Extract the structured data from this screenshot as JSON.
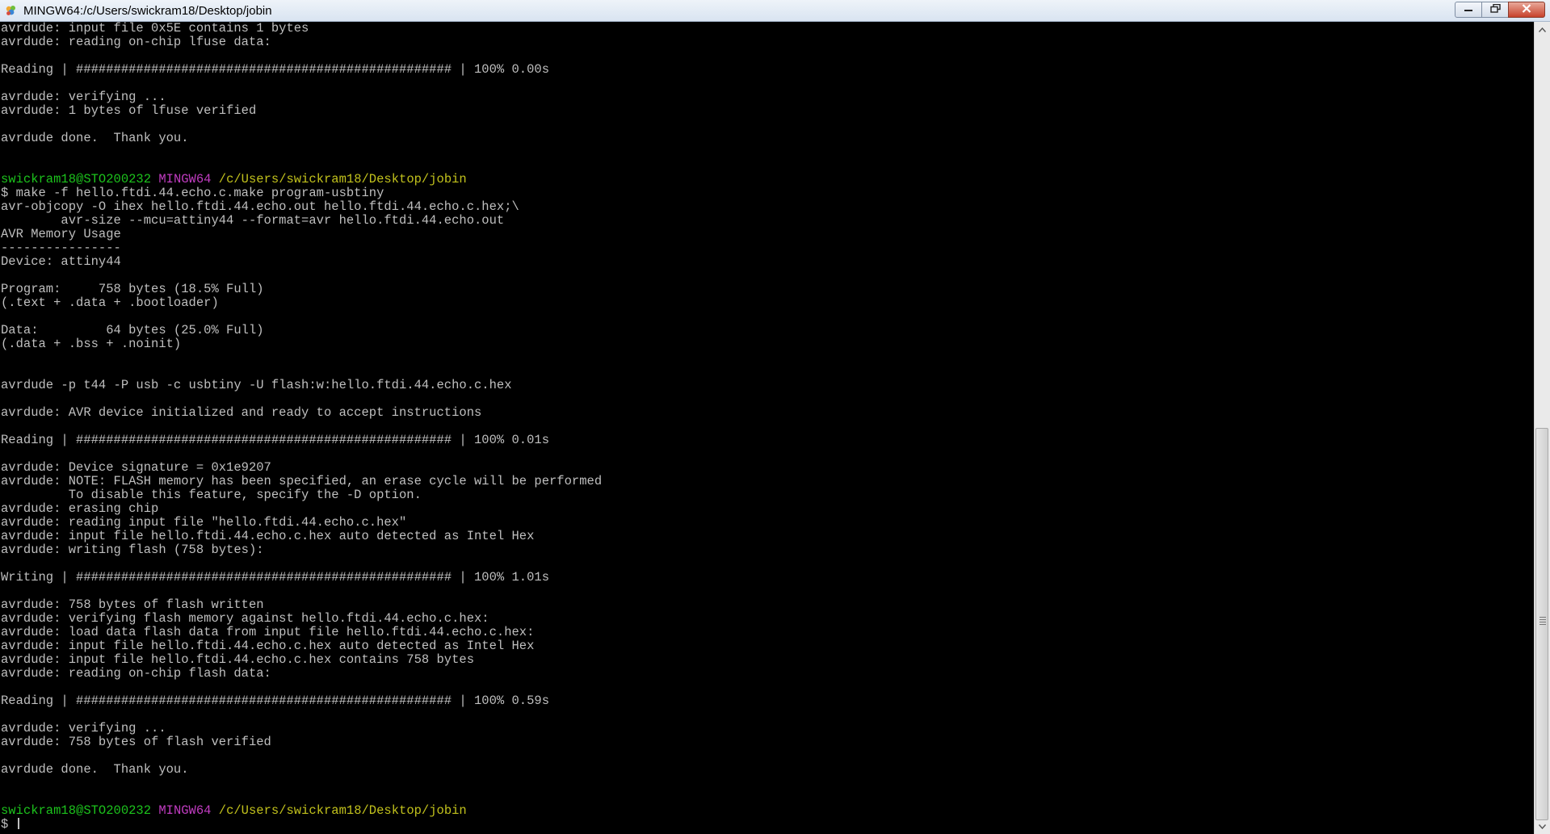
{
  "window": {
    "title": "MINGW64:/c/Users/swickram18/Desktop/jobin",
    "colors": {
      "prompt_user": "#1cc31c",
      "prompt_shell": "#c13cc1",
      "prompt_path": "#c1c11c",
      "text": "#bfbfbf",
      "background": "#000000"
    }
  },
  "terminal": {
    "lines": [
      "avrdude: input file 0x5E contains 1 bytes",
      "avrdude: reading on-chip lfuse data:",
      "",
      "Reading | ################################################## | 100% 0.00s",
      "",
      "avrdude: verifying ...",
      "avrdude: 1 bytes of lfuse verified",
      "",
      "avrdude done.  Thank you.",
      "",
      "",
      {
        "prompt": {
          "user": "swickram18@STO200232",
          "shell": "MINGW64",
          "path": "/c/Users/swickram18/Desktop/jobin"
        }
      },
      "$ make -f hello.ftdi.44.echo.c.make program-usbtiny",
      "avr-objcopy -O ihex hello.ftdi.44.echo.out hello.ftdi.44.echo.c.hex;\\",
      "        avr-size --mcu=attiny44 --format=avr hello.ftdi.44.echo.out",
      "AVR Memory Usage",
      "----------------",
      "Device: attiny44",
      "",
      "Program:     758 bytes (18.5% Full)",
      "(.text + .data + .bootloader)",
      "",
      "Data:         64 bytes (25.0% Full)",
      "(.data + .bss + .noinit)",
      "",
      "",
      "avrdude -p t44 -P usb -c usbtiny -U flash:w:hello.ftdi.44.echo.c.hex",
      "",
      "avrdude: AVR device initialized and ready to accept instructions",
      "",
      "Reading | ################################################## | 100% 0.01s",
      "",
      "avrdude: Device signature = 0x1e9207",
      "avrdude: NOTE: FLASH memory has been specified, an erase cycle will be performed",
      "         To disable this feature, specify the -D option.",
      "avrdude: erasing chip",
      "avrdude: reading input file \"hello.ftdi.44.echo.c.hex\"",
      "avrdude: input file hello.ftdi.44.echo.c.hex auto detected as Intel Hex",
      "avrdude: writing flash (758 bytes):",
      "",
      "Writing | ################################################## | 100% 1.01s",
      "",
      "avrdude: 758 bytes of flash written",
      "avrdude: verifying flash memory against hello.ftdi.44.echo.c.hex:",
      "avrdude: load data flash data from input file hello.ftdi.44.echo.c.hex:",
      "avrdude: input file hello.ftdi.44.echo.c.hex auto detected as Intel Hex",
      "avrdude: input file hello.ftdi.44.echo.c.hex contains 758 bytes",
      "avrdude: reading on-chip flash data:",
      "",
      "Reading | ################################################## | 100% 0.59s",
      "",
      "avrdude: verifying ...",
      "avrdude: 758 bytes of flash verified",
      "",
      "avrdude done.  Thank you.",
      "",
      "",
      {
        "prompt": {
          "user": "swickram18@STO200232",
          "shell": "MINGW64",
          "path": "/c/Users/swickram18/Desktop/jobin"
        }
      },
      {
        "input": "$ "
      }
    ]
  },
  "icons": {
    "app": "mingw-app-icon",
    "minimize": "minimize-icon",
    "maximize": "restore-icon",
    "close": "close-icon",
    "scroll_up": "scroll-up-arrow-icon",
    "scroll_down": "scroll-down-arrow-icon"
  }
}
